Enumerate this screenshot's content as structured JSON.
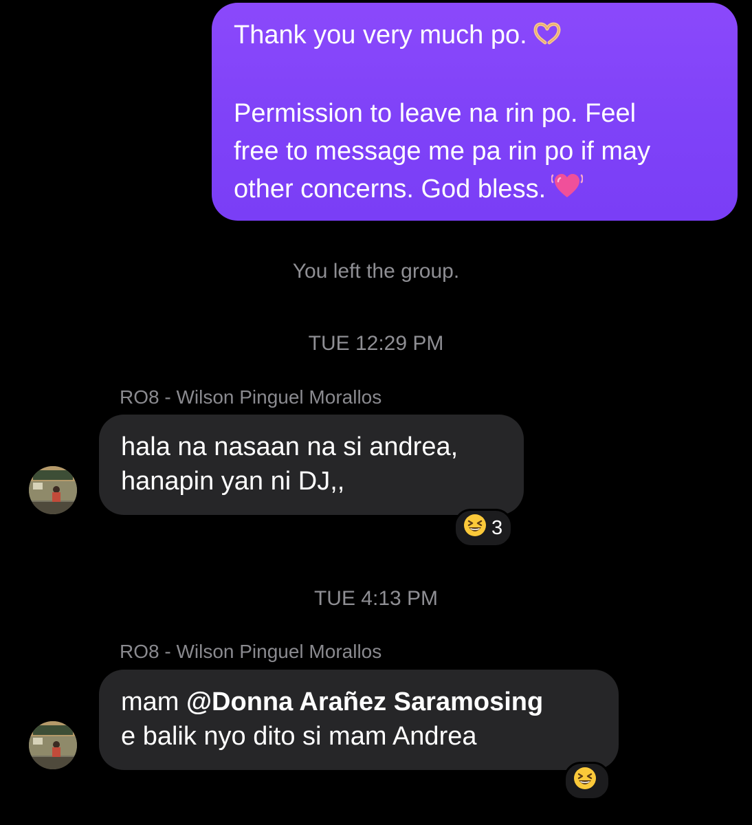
{
  "outgoing_message": {
    "lines": [
      "Thank you very much po.",
      "",
      "Permission to leave na rin po. Feel",
      "free to message me pa rin po if may",
      "other concerns. God bless."
    ],
    "line1_emoji": "heart-hands-emoji",
    "line5_emoji": "beating-heart-emoji"
  },
  "system_message": "You left the group.",
  "groups": [
    {
      "timestamp": "TUE 12:29 PM",
      "sender": "RO8 - Wilson Pinguel Morallos",
      "lines": [
        "hala na nasaan na si andrea,",
        "hanapin yan ni DJ,,"
      ],
      "reaction": {
        "emoji": "grinning-squinting-face-emoji",
        "count": "3"
      }
    },
    {
      "timestamp": "TUE 4:13 PM",
      "sender": "RO8 - Wilson Pinguel Morallos",
      "line1_prefix": "mam ",
      "mention": "@Donna Arañez Saramosing",
      "line2": "e balik nyo dito si mam Andrea",
      "reaction": {
        "emoji": "grinning-squinting-face-emoji",
        "count": ""
      }
    }
  ],
  "colors": {
    "background": "#000000",
    "outgoing_bubble": "#8046f8",
    "incoming_bubble": "#262628",
    "meta_text": "#8f8f94"
  }
}
